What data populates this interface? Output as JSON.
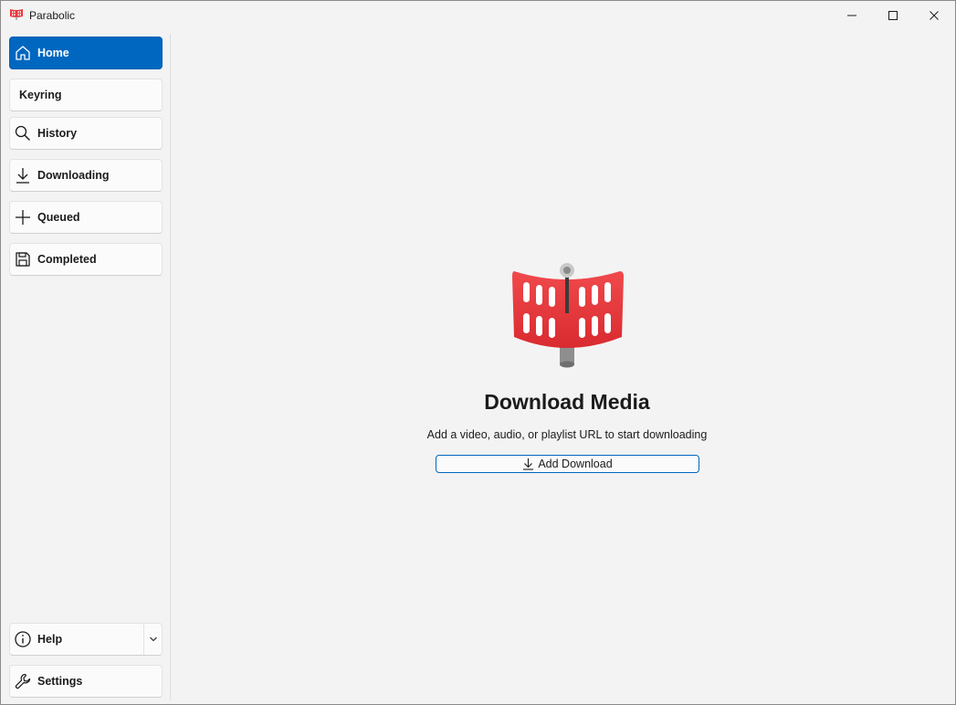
{
  "window": {
    "title": "Parabolic"
  },
  "titlebar": {
    "minimize_icon": "minimize-icon",
    "maximize_icon": "maximize-icon",
    "close_icon": "close-icon"
  },
  "sidebar": {
    "items": [
      {
        "label": "Home",
        "icon": "home-icon",
        "active": true
      },
      {
        "label": "Keyring",
        "icon": null,
        "active": false
      },
      {
        "label": "History",
        "icon": "search-icon",
        "active": false
      },
      {
        "label": "Downloading",
        "icon": "download-arrow-icon",
        "active": false
      },
      {
        "label": "Queued",
        "icon": "plus-icon",
        "active": false
      },
      {
        "label": "Completed",
        "icon": "save-icon",
        "active": false
      }
    ],
    "bottom": [
      {
        "label": "Help",
        "icon": "info-icon",
        "expander": "chevron-down-icon"
      },
      {
        "label": "Settings",
        "icon": "wrench-icon"
      }
    ]
  },
  "main": {
    "title": "Download Media",
    "subtitle": "Add a video, audio, or playlist URL to start downloading",
    "add_button_label": "Add Download",
    "add_button_icon": "download-arrow-icon"
  },
  "colors": {
    "accent": "#0067c0",
    "background": "#f3f3f3",
    "logo_red": "#e8373b"
  }
}
